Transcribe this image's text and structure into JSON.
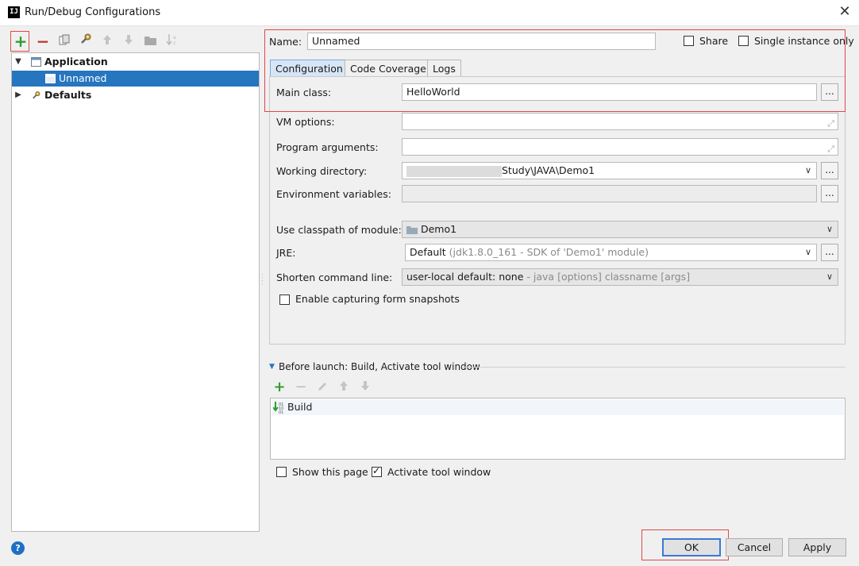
{
  "window": {
    "title": "Run/Debug Configurations",
    "app_icon": "IJ",
    "close_glyph": "✕"
  },
  "left_toolbar": {
    "add_glyph": "+",
    "remove_glyph": "−"
  },
  "tree": {
    "application": "Application",
    "unnamed": "Unnamed",
    "defaults": "Defaults"
  },
  "form": {
    "name_label": "Name:",
    "name_value": "Unnamed",
    "share_label": "Share",
    "single_instance_label": "Single instance only",
    "tabs": [
      "Configuration",
      "Code Coverage",
      "Logs"
    ],
    "main_class_label": "Main class:",
    "main_class_value": "HelloWorld",
    "vm_options_label": "VM options:",
    "program_arguments_label": "Program arguments:",
    "working_directory_label": "Working directory:",
    "working_directory_value": "Study\\JAVA\\Demo1",
    "environment_variables_label": "Environment variables:",
    "classpath_label": "Use classpath of module:",
    "classpath_value": "Demo1",
    "jre_label": "JRE:",
    "jre_value": "Default",
    "jre_hint": "(jdk1.8.0_161 - SDK of 'Demo1' module)",
    "shorten_label": "Shorten command line:",
    "shorten_value": "user-local default: none",
    "shorten_hint": "- java [options] classname [args]",
    "capture_label": "Enable capturing form snapshots",
    "dots": "..."
  },
  "before_launch": {
    "header": "Before launch: Build, Activate tool window",
    "items": [
      "Build"
    ],
    "show_page_label": "Show this page",
    "activate_label": "Activate tool window",
    "show_page_checked": false,
    "activate_checked": true
  },
  "buttons": {
    "help": "?",
    "ok": "OK",
    "cancel": "Cancel",
    "apply": "Apply"
  },
  "colors": {
    "selection": "#2675bf",
    "highlight_box": "#e04848",
    "add_green": "#2e9e2e",
    "remove_red": "#c0392b"
  }
}
